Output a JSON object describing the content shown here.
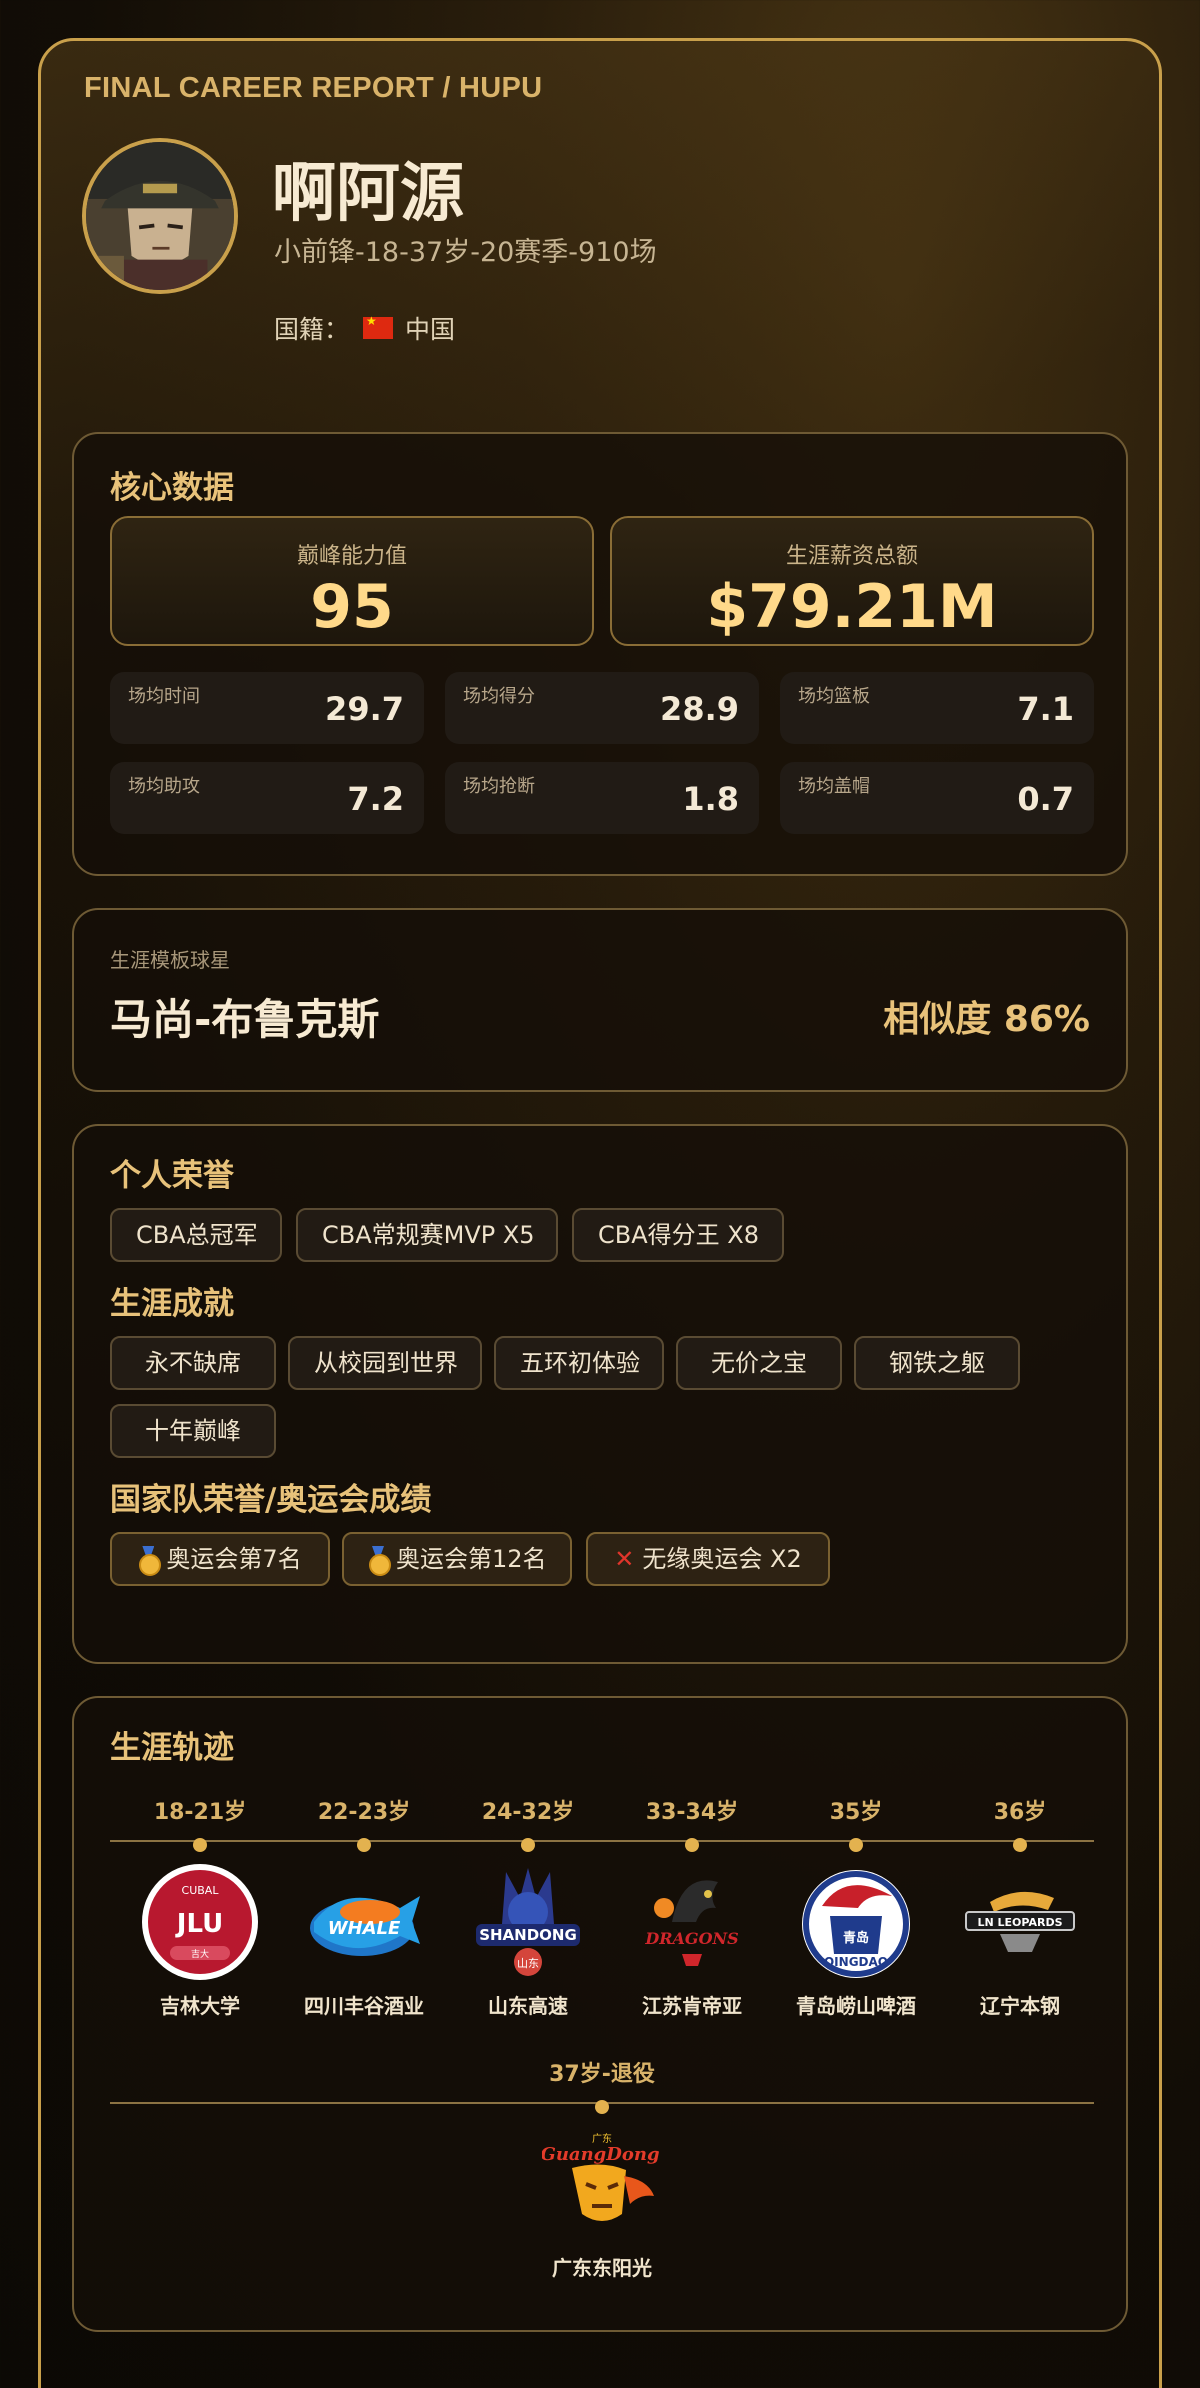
{
  "header": {
    "report_tag": "FINAL CAREER REPORT / HUPU",
    "player_name": "啊阿源",
    "subtitle": "小前锋-18-37岁-20赛季-910场",
    "nationality_label": "国籍：",
    "nationality": "中国"
  },
  "core": {
    "title": "核心数据",
    "peak_label": "巅峰能力值",
    "peak_value": "95",
    "salary_label": "生涯薪资总额",
    "salary_value": "$79.21M",
    "stats": [
      {
        "label": "场均时间",
        "value": "29.7"
      },
      {
        "label": "场均得分",
        "value": "28.9"
      },
      {
        "label": "场均篮板",
        "value": "7.1"
      },
      {
        "label": "场均助攻",
        "value": "7.2"
      },
      {
        "label": "场均抢断",
        "value": "1.8"
      },
      {
        "label": "场均盖帽",
        "value": "0.7"
      }
    ]
  },
  "template": {
    "label": "生涯模板球星",
    "player": "马尚-布鲁克斯",
    "similarity": "相似度 86%"
  },
  "honors": {
    "personal_title": "个人荣誉",
    "personal": [
      "CBA总冠军",
      "CBA常规赛MVP X5",
      "CBA得分王 X8"
    ],
    "career_title": "生涯成就",
    "career": [
      "永不缺席",
      "从校园到世界",
      "五环初体验",
      "无价之宝",
      "钢铁之躯",
      "十年巅峰"
    ],
    "national_title": "国家队荣誉/奥运会成绩",
    "national": [
      "奥运会第7名",
      "奥运会第12名",
      "无缘奥运会 X2"
    ]
  },
  "timeline": {
    "title": "生涯轨迹",
    "stops": [
      {
        "age": "18-21岁",
        "team": "吉林大学",
        "logo_text": "JLU",
        "logo_small": "CUBAL",
        "logo_tag": "吉大"
      },
      {
        "age": "22-23岁",
        "team": "四川丰谷酒业",
        "logo_text": "WHALE"
      },
      {
        "age": "24-32岁",
        "team": "山东高速",
        "logo_text": "SHANDONG",
        "logo_tag": "山东"
      },
      {
        "age": "33-34岁",
        "team": "江苏肯帝亚",
        "logo_text": "DRAGONS"
      },
      {
        "age": "35岁",
        "team": "青岛崂山啤酒",
        "logo_text": "QINGDAO",
        "logo_tag": "青岛"
      },
      {
        "age": "36岁",
        "team": "辽宁本钢",
        "logo_text": "LN LEOPARDS"
      }
    ],
    "final": {
      "age": "37岁-退役",
      "team": "广东东阳光",
      "logo_text": "GuangDong",
      "logo_tag": "广东"
    }
  },
  "colors": {
    "accent": "#e8c27a",
    "border": "#c9a04b",
    "background": "#120d06"
  }
}
